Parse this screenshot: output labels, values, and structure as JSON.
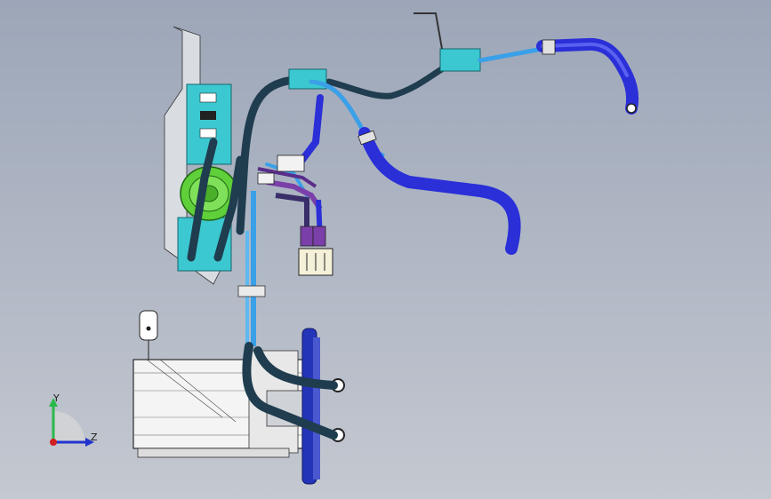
{
  "scene": {
    "title": "",
    "colors": {
      "background_top": "#9ca6b8",
      "background_bottom": "#c4c8d0",
      "hose_dark": "#1f3d4f",
      "hose_blue": "#2a2fd8",
      "hose_light_blue": "#3aa0e8",
      "bracket_cyan": "#3cc8d0",
      "canister_green": "#5fcf3a",
      "connector_purple": "#7a3fa8",
      "tank_outline": "#2a2a2a",
      "flange_blue": "#2434b8"
    }
  },
  "triad": {
    "y_label": "Y",
    "z_label": "Z",
    "y_color": "#2ab84a",
    "z_color": "#2233cc",
    "x_color": "#d02020"
  }
}
